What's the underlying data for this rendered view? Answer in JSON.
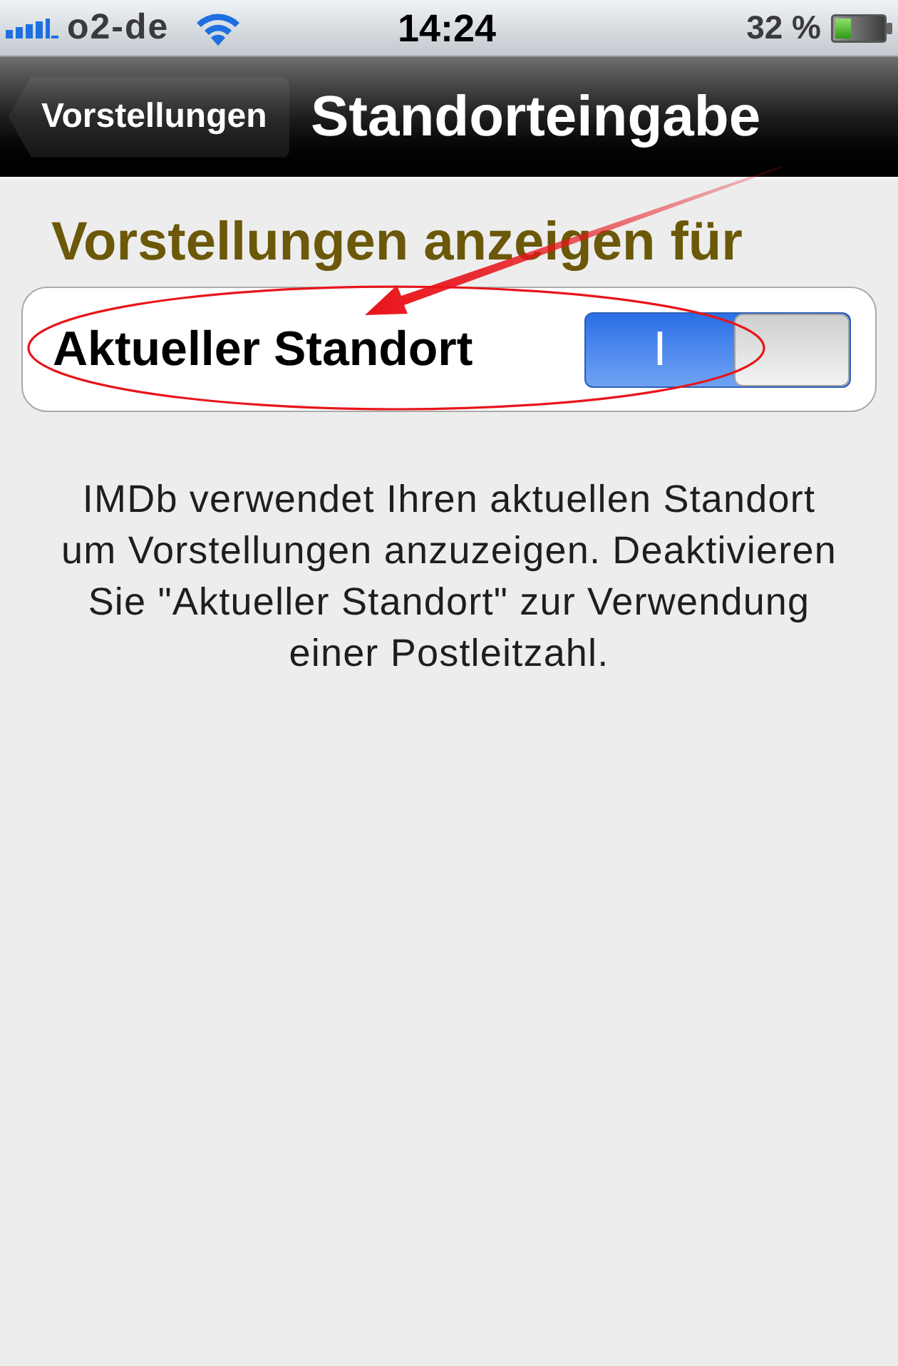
{
  "status_bar": {
    "carrier": "o2-de",
    "time": "14:24",
    "battery": "32 %"
  },
  "nav_bar": {
    "back_button": "Vorstellungen",
    "title": "Standorteingabe"
  },
  "section": {
    "header": "Vorstellungen anzeigen für",
    "rows": [
      {
        "kind": "switch",
        "label": "Aktueller Standort",
        "on": true,
        "on_label": "I"
      }
    ],
    "footer": "IMDb verwendet Ihren aktuellen Standort um Vorstellungen anzuzeigen. Deaktivieren Sie \"Aktueller Standort\" zur Verwendung einer Postleitzahl."
  }
}
